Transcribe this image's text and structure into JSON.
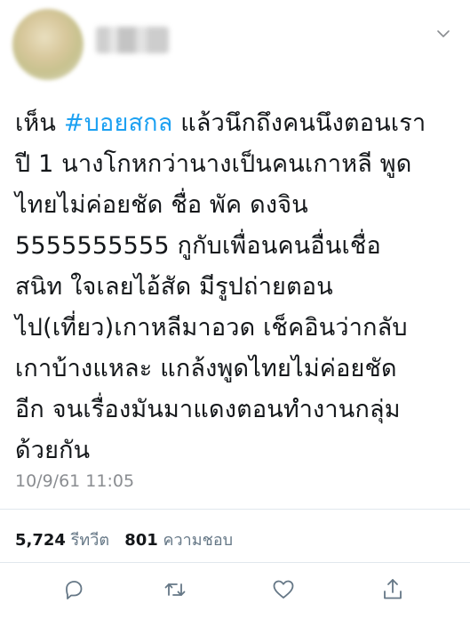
{
  "tweet": {
    "hashtag": "#บอยสกล",
    "lines": {
      "l1_rest": " แล้วนึกถึงคนนึงตอนเรา",
      "l1_prefix": "เห็น ",
      "l2": "ปี 1 นางโกหกว่านางเป็นคนเกาหลี พูด",
      "l3": "ไทยไม่ค่อยชัด ชื่อ พัค ดงจิน",
      "l4": "5555555555 กูกับเพื่อนคนอื่นเชื่อ",
      "l5": "สนิท ใจเลยไอ้สัด มีรูปถ่ายตอน",
      "l6": "ไป(เที่ยว)เกาหลีมาอวด เช็คอินว่ากลับ",
      "l7": "เกาบ้างแหละ แกล้งพูดไทยไม่ค่อยชัด",
      "l8": "อีก จนเรื่องมันมาแดงตอนทำงานกลุ่ม",
      "l9": "ด้วยกัน"
    },
    "timestamp": "10/9/61 11:05"
  },
  "stats": {
    "retweets_count": "5,724",
    "retweets_label": "รีทวีต",
    "likes_count": "801",
    "likes_label": "ความชอบ"
  },
  "icons": {
    "more": "chevron-down-icon",
    "reply": "reply-icon",
    "retweet": "retweet-icon",
    "like": "heart-icon",
    "share": "share-icon"
  },
  "colors": {
    "hashtag": "#1da1f2",
    "text": "#14171a",
    "meta": "#8a8d91",
    "icon": "#657786",
    "divider": "#e1e8ed"
  }
}
